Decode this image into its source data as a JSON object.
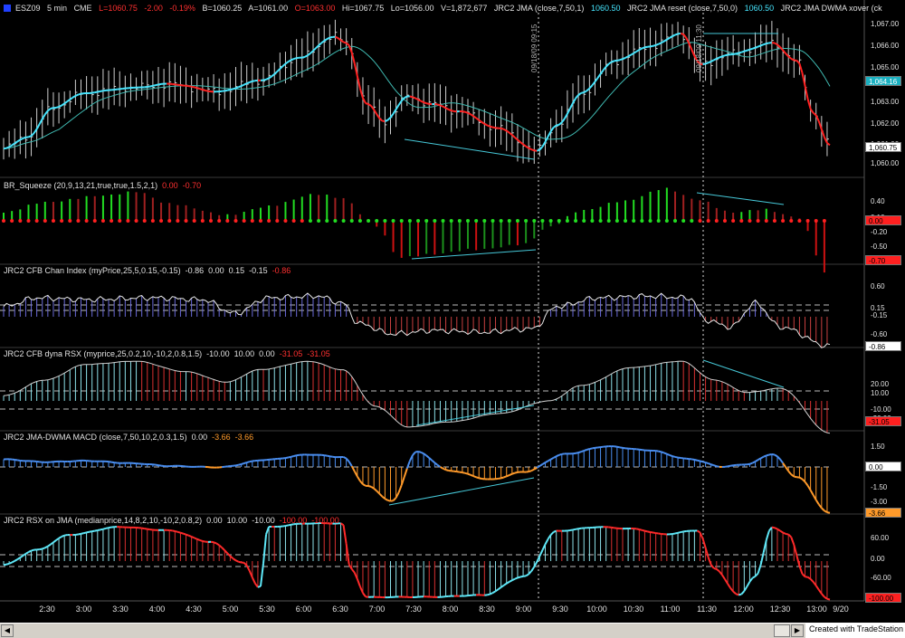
{
  "window": {
    "symbol": "ESZ09",
    "interval": "5 min",
    "exchange": "CME",
    "symbol_icon": "square-blue-icon"
  },
  "quote_header": {
    "last": "L=1060.75",
    "change": "-2.00",
    "change_pct": "-0.19%",
    "bid": "B=1060.25",
    "ask": "A=1061.00",
    "open": "O=1063.00",
    "high": "Hi=1067.75",
    "low": "Lo=1056.00",
    "volume": "V=1,872,677",
    "ind1_name": "JRC2 JMA (close,7,50,1)",
    "ind1_value": "1060.50",
    "ind2_name": "JRC2 JMA reset (close,7,50,0)",
    "ind2_value": "1060.50",
    "ind3_name": "JRC2 JMA DWMA xover (ck"
  },
  "price_axis": {
    "ticks": [
      "1,067.00",
      "1,066.00",
      "1,065.00",
      "1,063.00",
      "1,062.00",
      "1,061.00",
      "1,060.00"
    ],
    "last_price": "1,060.75",
    "jma_box": "1,064.16",
    "box_colors": {
      "last": "#ffffff",
      "jma": "#1ab0c0"
    }
  },
  "vertical_markers": [
    {
      "label": "09/18/09 09:15"
    },
    {
      "label": "09/18/09 11:30"
    }
  ],
  "panes": [
    {
      "id": "squeeze",
      "title": "BR_Squeeze (20,9,13,21,true,true,1.5,2,1)",
      "values": [
        {
          "text": "0.00",
          "cls": "v-red"
        },
        {
          "text": "-0.70",
          "cls": "v-red"
        }
      ],
      "axis_ticks": [
        "0.40",
        "0.10",
        "-0.20",
        "-0.50"
      ],
      "last_box": "-0.70",
      "last_box_color": "#ff2020",
      "zero_box": "0.00"
    },
    {
      "id": "chan",
      "title": "JRC2 CFB Chan Index (myPrice,25,5,0.15,-0.15)",
      "values": [
        {
          "text": "-0.86",
          "cls": "v-white"
        },
        {
          "text": "0.00",
          "cls": "v-white"
        },
        {
          "text": "0.15",
          "cls": "v-white"
        },
        {
          "text": "-0.15",
          "cls": "v-white"
        },
        {
          "text": "-0.86",
          "cls": "v-red"
        }
      ],
      "axis_ticks": [
        "0.60",
        "0.15",
        "-0.15",
        "-0.60"
      ],
      "last_box": "-0.86",
      "last_box_color": "#ffffff"
    },
    {
      "id": "dyna",
      "title": "JRC2 CFB dyna RSX (myprice,25,0.2,10,-10,2,0.8,1.5)",
      "values": [
        {
          "text": "-10.00",
          "cls": "v-white"
        },
        {
          "text": "10.00",
          "cls": "v-white"
        },
        {
          "text": "0.00",
          "cls": "v-white"
        },
        {
          "text": "-31.05",
          "cls": "v-red"
        },
        {
          "text": "-31.05",
          "cls": "v-red"
        }
      ],
      "axis_ticks": [
        "20.00",
        "10.00",
        "-10.00",
        "-20.00"
      ],
      "last_box": "-31.05",
      "last_box_color": "#ff2020"
    },
    {
      "id": "macd",
      "title": "JRC2 JMA-DWMA MACD (close,7,50,10,2,0.3,1.5)",
      "values": [
        {
          "text": "0.00",
          "cls": "v-white"
        },
        {
          "text": "-3.66",
          "cls": "v-orange"
        },
        {
          "text": "-3.66",
          "cls": "v-orange"
        }
      ],
      "axis_ticks": [
        "1.50",
        "0.00",
        "-1.50",
        "-3.00"
      ],
      "last_box": "-3.66",
      "last_box_color": "#ff9a2a"
    },
    {
      "id": "rsx",
      "title": "JRC2 RSX on JMA (medianprice,14,8,2,10,-10,2,0.8,2)",
      "values": [
        {
          "text": "0.00",
          "cls": "v-white"
        },
        {
          "text": "10.00",
          "cls": "v-white"
        },
        {
          "text": "-10.00",
          "cls": "v-white"
        },
        {
          "text": "-100.00",
          "cls": "v-red"
        },
        {
          "text": "-100.00",
          "cls": "v-red"
        }
      ],
      "axis_ticks": [
        "60.00",
        "0.00",
        "-60.00"
      ],
      "last_box": "-100.00",
      "last_box_color": "#ff2020"
    }
  ],
  "time_axis": [
    "2:30",
    "3:00",
    "3:30",
    "4:00",
    "4:30",
    "5:00",
    "5:30",
    "6:00",
    "6:30",
    "7:00",
    "7:30",
    "8:00",
    "8:30",
    "9:00",
    "9:30",
    "10:00",
    "10:30",
    "11:00",
    "11:30",
    "12:00",
    "12:30",
    "13:00",
    "9/20"
  ],
  "footer": {
    "note": "Created with TradeStation"
  },
  "colors": {
    "background": "#000000",
    "up": "#46e6ff",
    "down": "#ff2020",
    "squeeze_up": "#22dd22",
    "squeeze_down": "#cc1111",
    "chan_up": "#6a6ad8",
    "chan_down": "#c84040",
    "macd_up": "#4a8ef0",
    "macd_down": "#ff9a2a",
    "hist_cyan": "#8ce0e8",
    "hist_red": "#d83030"
  },
  "scrollbar": {
    "left_icon": "arrow-left-icon",
    "right_icon": "arrow-right-icon"
  }
}
